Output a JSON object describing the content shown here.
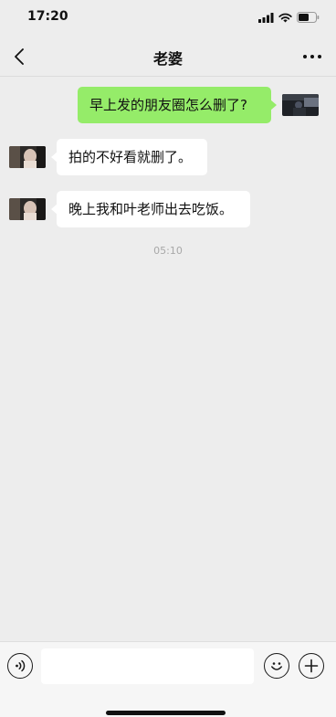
{
  "status_bar": {
    "time": "17:20"
  },
  "nav": {
    "title": "老婆"
  },
  "messages": [
    {
      "side": "sent",
      "text": "早上发的朋友圈怎么删了?"
    },
    {
      "side": "received",
      "text": "拍的不好看就删了。"
    },
    {
      "side": "received",
      "text": "晚上我和叶老师出去吃饭。"
    }
  ],
  "timestamp": "05:10",
  "input": {
    "value": "",
    "placeholder": ""
  },
  "colors": {
    "background": "#ededed",
    "sent_bubble": "#95ec69",
    "received_bubble": "#ffffff",
    "input_bar": "#f6f6f6"
  },
  "icons": {
    "back": "chevron-left-icon",
    "more": "more-horizontal-icon",
    "voice": "voice-icon",
    "emoji": "emoji-icon",
    "plus": "plus-icon"
  }
}
